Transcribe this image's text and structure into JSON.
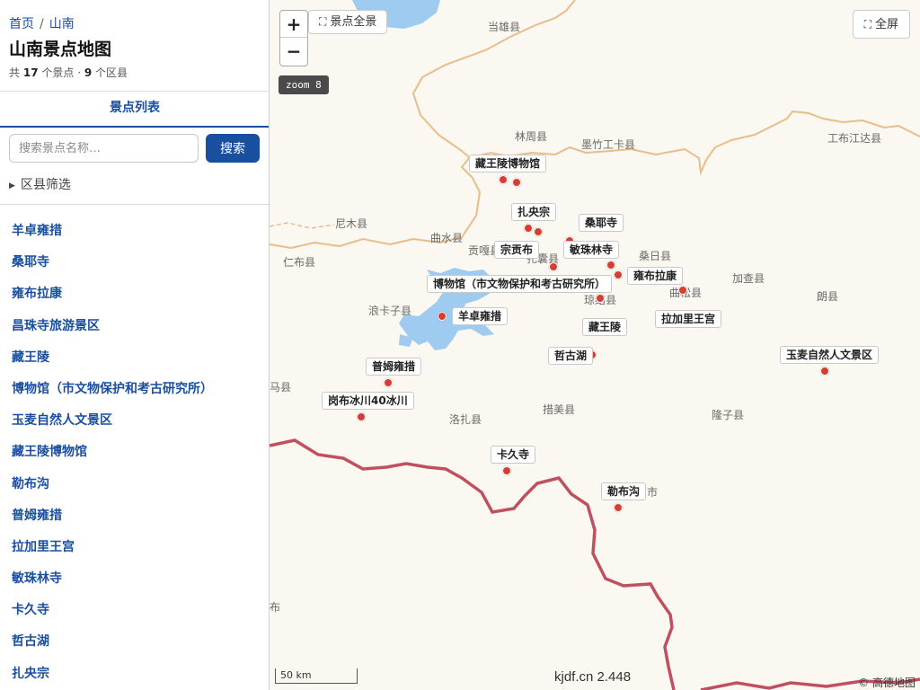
{
  "breadcrumb": {
    "home": "首页",
    "separator": "/",
    "current": "山南"
  },
  "title": "山南景点地图",
  "summary": {
    "prefix": "共",
    "poi_count": "17",
    "poi_unit": "个景点 ·",
    "county_count": "9",
    "county_unit": "个区县"
  },
  "tab": "景点列表",
  "search": {
    "placeholder": "搜索景点名称…",
    "value": "",
    "button": "搜索"
  },
  "filter": {
    "label": "区县筛选",
    "icon": "triangle-right-icon"
  },
  "poi_list": [
    "羊卓雍措",
    "桑耶寺",
    "雍布拉康",
    "昌珠寺旅游景区",
    "藏王陵",
    "博物馆（市文物保护和考古研究所）",
    "玉麦自然人文景区",
    "藏王陵博物馆",
    "勒布沟",
    "普姆雍措",
    "拉加里王宫",
    "敏珠林寺",
    "卡久寺",
    "哲古湖",
    "扎央宗"
  ],
  "map": {
    "zoom_in": "+",
    "zoom_out": "−",
    "overview_button": "景点全景",
    "fullscreen_button": "全屏",
    "zoom_badge": "zoom 8",
    "scale": "50 km",
    "watermark": "kjdf.cn 2.448",
    "attribution": "© 高德地图",
    "place_names": [
      "当雄县",
      "林周县",
      "墨竹工卡县",
      "工布江达县",
      "尼木县",
      "曲水县",
      "贡嘎县",
      "扎囊县",
      "桑日县",
      "仁布县",
      "加查县",
      "朗县",
      "浪卡子县",
      "琼结县",
      "曲松县",
      "马县",
      "措美县",
      "隆子县",
      "洛扎县",
      "市",
      "布"
    ],
    "poi_labels": [
      "藏王陵博物馆",
      "扎央宗",
      "桑耶寺",
      "宗贡布",
      "敏珠林寺",
      "雍布拉康",
      "博物馆（市文物保护和考古研究所）",
      "羊卓雍措",
      "藏王陵",
      "拉加里王宫",
      "哲古湖",
      "玉麦自然人文景区",
      "普姆雍措",
      "岗布冰川40冰川",
      "卡久寺",
      "勒布沟"
    ],
    "colors": {
      "marker": "#d83b30",
      "lake": "#9fcbf0",
      "border": "#c05060",
      "province_line": "#e9bd8a",
      "land": "#fbf8f1"
    }
  }
}
